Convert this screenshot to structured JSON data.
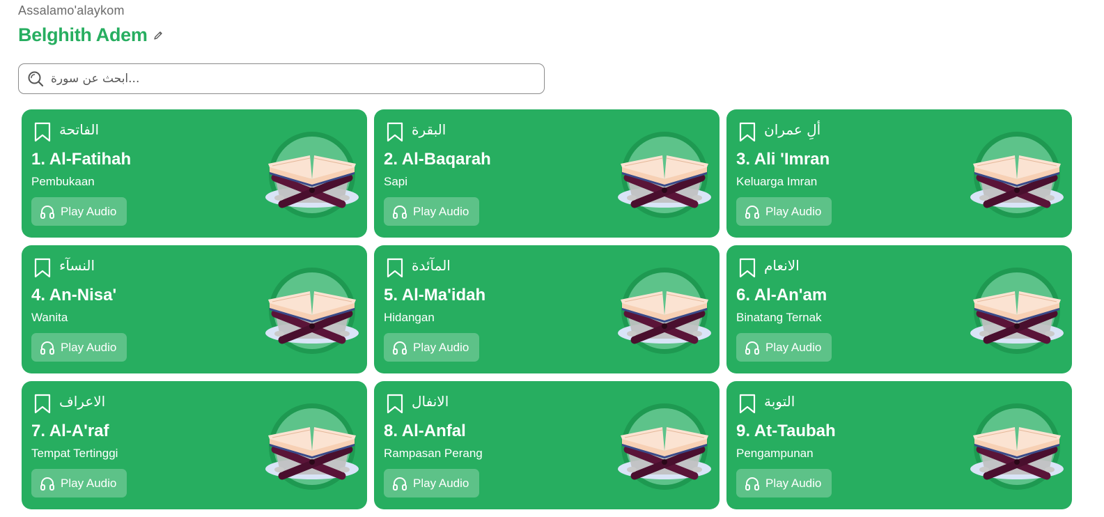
{
  "header": {
    "greeting": "Assalamo'alaykom",
    "user_name": "Belghith Adem",
    "edit_icon": "pencil-icon"
  },
  "search": {
    "placeholder": "ابحث عن سورة...",
    "icon": "search-icon"
  },
  "colors": {
    "brand": "#27ae60",
    "card_bg": "#27ae60",
    "light_green": "#5dc38a",
    "dark_green": "#1e9951",
    "text_white": "#ffffff",
    "greeting_gray": "#6b6b6b"
  },
  "surahs": [
    {
      "arabic": "الفاتحة",
      "title": "1. Al-Fatihah",
      "meaning": "Pembukaan",
      "play_label": "Play Audio"
    },
    {
      "arabic": "البقرة",
      "title": "2. Al-Baqarah",
      "meaning": "Sapi",
      "play_label": "Play Audio"
    },
    {
      "arabic": "ألِ عمران",
      "title": "3. Ali 'Imran",
      "meaning": "Keluarga Imran",
      "play_label": "Play Audio"
    },
    {
      "arabic": "النسآء",
      "title": "4. An-Nisa'",
      "meaning": "Wanita",
      "play_label": "Play Audio"
    },
    {
      "arabic": "المآئدة",
      "title": "5. Al-Ma'idah",
      "meaning": "Hidangan",
      "play_label": "Play Audio"
    },
    {
      "arabic": "الانعام",
      "title": "6. Al-An'am",
      "meaning": "Binatang Ternak",
      "play_label": "Play Audio"
    },
    {
      "arabic": "الاعراف",
      "title": "7. Al-A'raf",
      "meaning": "Tempat Tertinggi",
      "play_label": "Play Audio"
    },
    {
      "arabic": "الانفال",
      "title": "8. Al-Anfal",
      "meaning": "Rampasan Perang",
      "play_label": "Play Audio"
    },
    {
      "arabic": "التوبة",
      "title": "9. At-Taubah",
      "meaning": "Pengampunan",
      "play_label": "Play Audio"
    }
  ]
}
